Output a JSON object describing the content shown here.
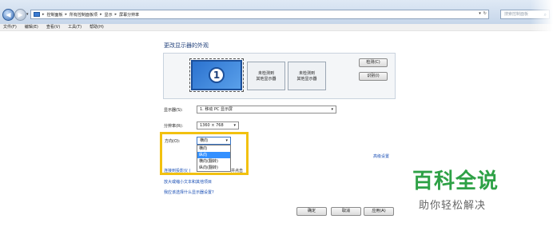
{
  "window": {
    "address": {
      "breadcrumbs": [
        "控制面板",
        "所有控制面板项",
        "显示",
        "屏幕分辨率"
      ]
    },
    "search_placeholder": "搜索控制面板"
  },
  "menu": [
    "文件(F)",
    "编辑(E)",
    "查看(V)",
    "工具(T)",
    "帮助(H)"
  ],
  "main": {
    "title": "更改显示器的外观",
    "monitors": {
      "primary_number": "1",
      "undetected_1": "未检测到\n其他显示器",
      "undetected_2": "未检测到\n其他显示器"
    },
    "buttons": {
      "detect": "检测(C)",
      "identify": "识别(I)"
    },
    "display": {
      "label": "显示器(S):",
      "value": "1. 移动 PC 显示屏"
    },
    "resolution": {
      "label": "分辨率(R):",
      "value": "1360 × 768"
    },
    "orientation": {
      "label": "方向(O):",
      "value": "横向",
      "options": [
        "横向",
        "纵向",
        "横向(翻转)",
        "纵向(翻转)"
      ],
      "highlighted_index": 1
    },
    "advanced_link": "高级设置",
    "links": {
      "connect_projector_prefix": "连接到投影仪 (",
      "connect_projector_suffix": "并点击",
      "bigger_text": "放大或缩小文本和其他项目",
      "which_settings": "我应该选择什么显示器设置?"
    },
    "footer": {
      "ok": "确定",
      "cancel": "取消",
      "apply": "应用(A)"
    }
  },
  "watermark": {
    "brand": "百科全说",
    "slogan": "助你轻松解决"
  }
}
